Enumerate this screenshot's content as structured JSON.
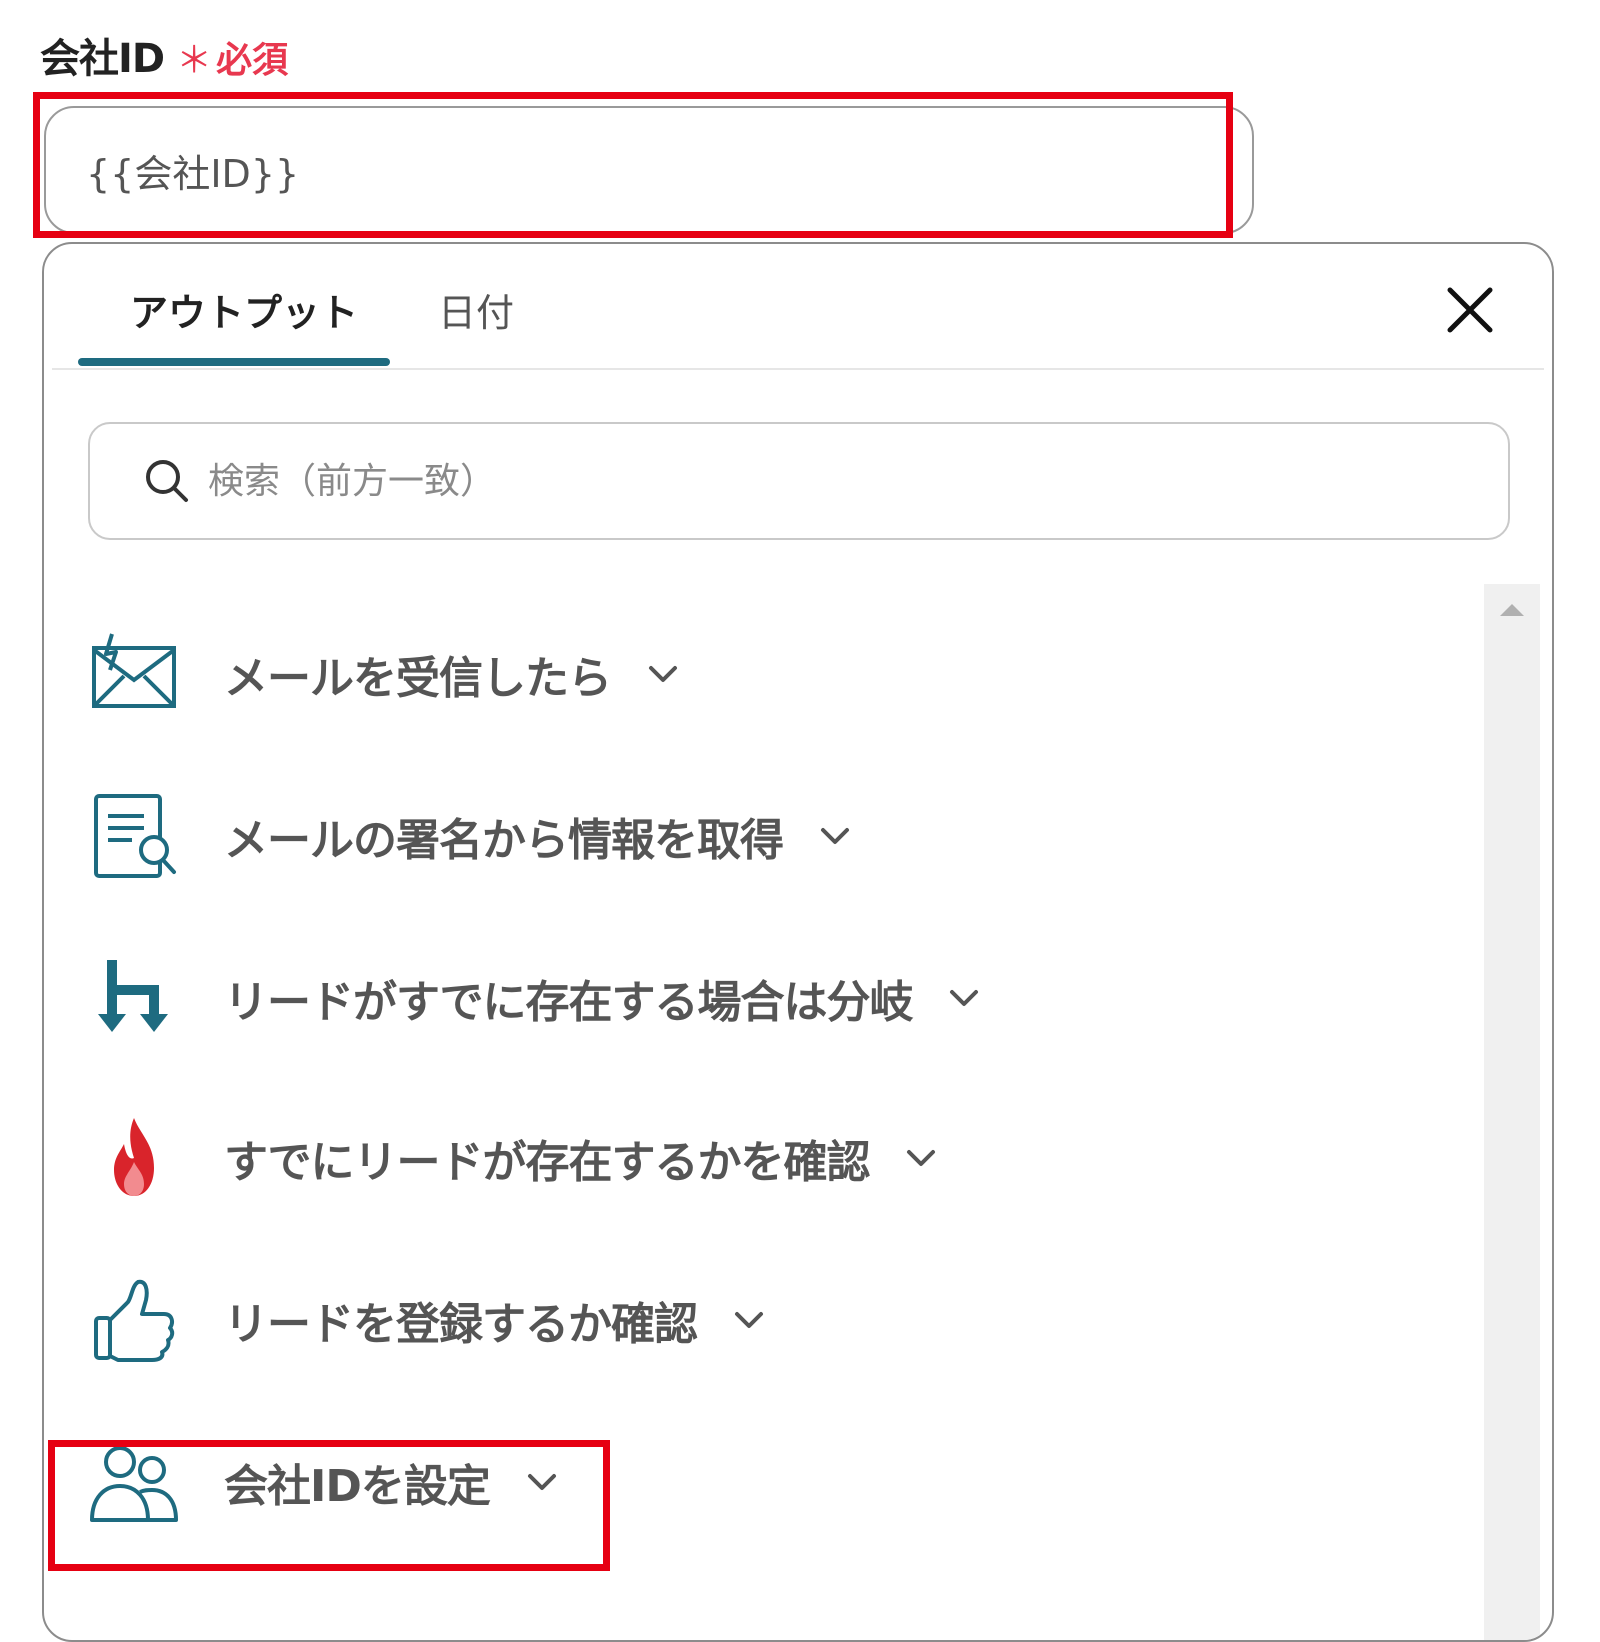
{
  "field": {
    "label": "会社ID",
    "required_mark": "＊",
    "required_text": "必須",
    "value": "{{会社ID}}"
  },
  "panel": {
    "tabs": [
      {
        "label": "アウトプット",
        "active": true
      },
      {
        "label": "日付",
        "active": false
      }
    ],
    "search_placeholder": "検索（前方一致）",
    "items": [
      {
        "label": "メールを受信したら",
        "icon": "mail-trigger-icon"
      },
      {
        "label": "メールの署名から情報を取得",
        "icon": "document-search-icon"
      },
      {
        "label": "リードがすでに存在する場合は分岐",
        "icon": "branch-icon"
      },
      {
        "label": "すでにリードが存在するかを確認",
        "icon": "flame-icon"
      },
      {
        "label": "リードを登録するか確認",
        "icon": "thumbs-up-icon"
      },
      {
        "label": "会社IDを設定",
        "icon": "users-icon"
      }
    ]
  },
  "colors": {
    "accent": "#1e6b80",
    "required": "#e8384f",
    "highlight": "#e60012",
    "flame": "#d9242b"
  }
}
